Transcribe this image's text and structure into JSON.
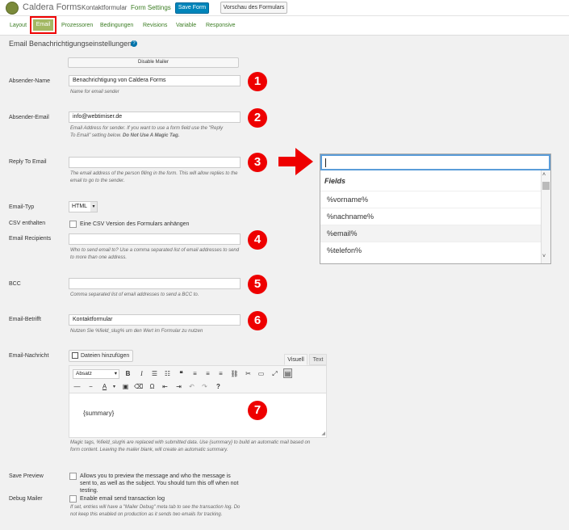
{
  "topbar": {
    "logo": "Caldera Forms",
    "form_name": "Kontaktformular",
    "settings_link": "Form Settings",
    "save_label": "Save Form",
    "preview_label": "Vorschau des Formulars"
  },
  "tabs": [
    "Layout",
    "Email",
    "Prozessoren",
    "Bedingungen",
    "Revisions",
    "Variable",
    "Responsive"
  ],
  "section_title": "Email Benachrichtigungseinstellungen",
  "help_icon": "?",
  "disable_mailer_label": "Disable Mailer",
  "fields": {
    "sender_name": {
      "label": "Absender-Name",
      "value": "Benachrichtigung von Caldera Forms",
      "desc": "Name for email sender"
    },
    "sender_email": {
      "label": "Absender-Email",
      "value": "info@webtimiser.de",
      "desc_1": "Email Address for sender. If you want to use a form field use the \"Reply",
      "desc_2": "To Email\" setting below. ",
      "desc_bold": "Do Not Use A Magic Tag."
    },
    "reply_to": {
      "label": "Reply To Email",
      "value": "",
      "desc": "The email address of the person filling in the form. This will allow replies to the email to go to the sender."
    },
    "email_type": {
      "label": "Email-Typ",
      "value": "HTML"
    },
    "csv": {
      "label": "CSV enthalten",
      "checkbox_label": "Eine CSV Version des Formulars anhängen"
    },
    "recipients": {
      "label": "Email Recipients",
      "value": "",
      "desc": "Who to send email to? Use a comma separated list of email addresses to send to more than one address."
    },
    "bcc": {
      "label": "BCC",
      "value": "",
      "desc": "Comma separated list of email addresses to send a BCC to."
    },
    "subject": {
      "label": "Email-Betrifft",
      "value": "Kontaktformular",
      "desc": "Nutzen Sie %field_slug% um den Wert im Formular zu nutzen"
    },
    "message": {
      "label": "Email-Nachricht",
      "media_button": "Dateien hinzufügen",
      "tab_visual": "Visuell",
      "tab_text": "Text",
      "format_select": "Absatz",
      "content": "{summary}",
      "desc": "Magic tags, %field_slug% are replaced with submitted data. Use {summary} to build an automatic mail based on form content. Leaving the mailer blank, will create an automatic summary."
    },
    "save_preview": {
      "label": "Save Preview",
      "checkbox_label": "Allows you to preview the message and who the message is sent to, as well as the subject. You should turn this off when not testing."
    },
    "debug_mailer": {
      "label": "Debug Mailer",
      "checkbox_label": "Enable email send transaction log",
      "desc": "If set, entries will have a \"Mailer Debug\" meta tab to see the transaction log. Do not keep this enabled on production as it sends two emails for tracking."
    }
  },
  "dropdown": {
    "group": "Fields",
    "items": [
      "%vorname%",
      "%nachname%",
      "%email%",
      "%telefon%"
    ]
  },
  "markers": [
    "1",
    "2",
    "3",
    "4",
    "5",
    "6",
    "7"
  ],
  "colors": {
    "accent": "#a3b863",
    "marker": "#e00000",
    "primary_button": "#0085ba"
  }
}
